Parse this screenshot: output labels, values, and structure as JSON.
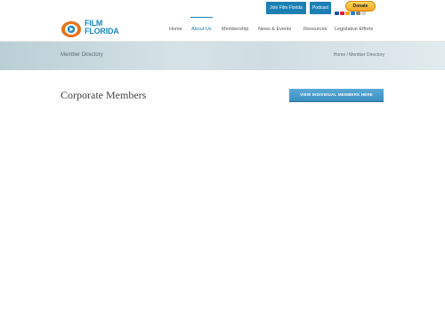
{
  "top_buttons": {
    "join_label": "Join Film Florida",
    "podcast_label": "Podcast",
    "donate_label": "Donate",
    "card_colors": [
      "#1a4fa0",
      "#e21836",
      "#f7a400",
      "#2a7ad6",
      "#888888",
      "#d0d0d0"
    ]
  },
  "logo": {
    "line1": "FILM",
    "line2": "FLORIDA",
    "brand_color": "#1c8bc2",
    "eye_color": "#e8731a"
  },
  "nav": {
    "items": [
      "Home",
      "About Us",
      "Membership",
      "News & Events",
      "Resources",
      "Legislative Efforts"
    ],
    "active_index": 1
  },
  "banner": {
    "title": "Member Directory",
    "breadcrumb": "Home / Member Directory"
  },
  "main": {
    "section_title": "Corporate Members",
    "cta_label": "VIEW INDIVIDUAL MEMBERS HERE"
  },
  "colors": {
    "accent": "#1c7fb3",
    "button": "#3a8fc1"
  }
}
